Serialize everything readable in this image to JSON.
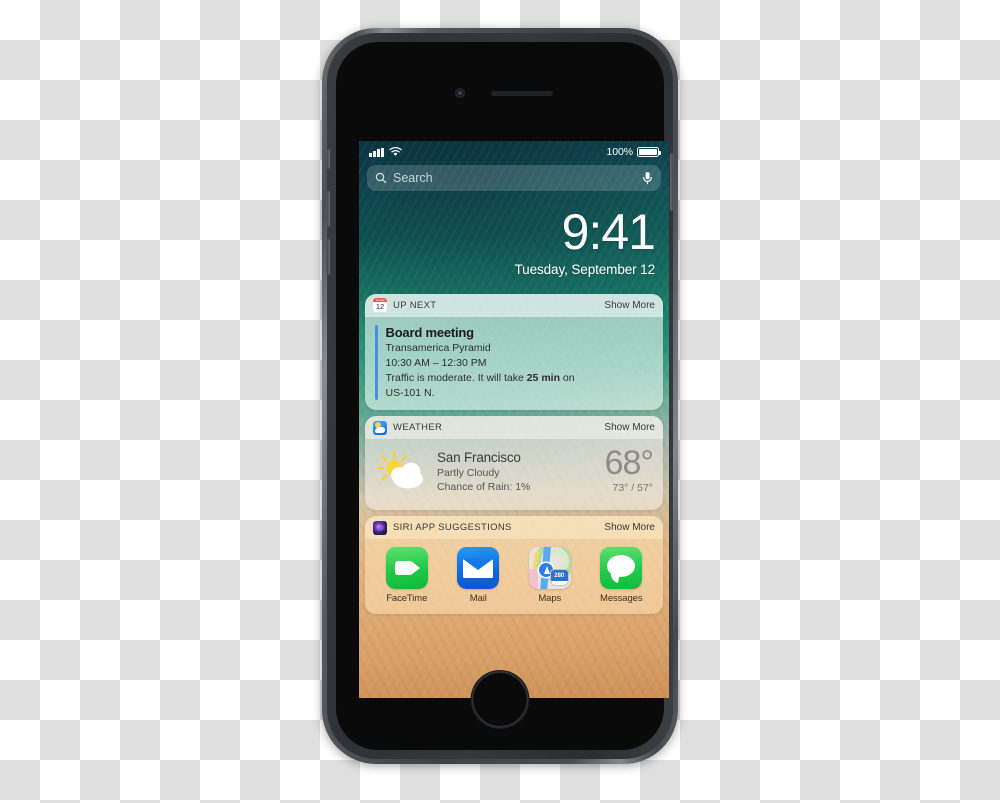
{
  "device": {
    "model_name": "iPhone",
    "home_button": "home-button",
    "camera": "front-camera",
    "speaker": "earpiece-speaker"
  },
  "status_bar": {
    "signal_icon": "cellular-signal-icon",
    "wifi_icon": "wifi-icon",
    "battery_percent": "100%",
    "battery_icon": "battery-full-icon"
  },
  "search": {
    "placeholder": "Search",
    "icon": "search-icon",
    "mic_icon": "microphone-icon"
  },
  "lockscreen": {
    "time": "9:41",
    "date": "Tuesday, September 12"
  },
  "widgets": [
    {
      "id": "up-next",
      "icon": "calendar-icon",
      "title": "UP NEXT",
      "show_more": "Show More",
      "accent_color": "#4a90e2",
      "calendar_icon": {
        "weekday": "Tuesday",
        "day": "12"
      },
      "event": {
        "title": "Board meeting",
        "location": "Transamerica Pyramid",
        "time_range": "10:30 AM – 12:30 PM",
        "traffic_prefix": "Traffic is moderate. It will take ",
        "traffic_duration": "25 min",
        "traffic_suffix": " on",
        "route": "US-101 N."
      }
    },
    {
      "id": "weather",
      "icon": "weather-icon",
      "title": "WEATHER",
      "show_more": "Show More",
      "condition_icon": "sun-behind-cloud-icon",
      "city": "San Francisco",
      "condition": "Partly Cloudy",
      "chance_of_rain": "Chance of Rain: 1%",
      "temperature": "68°",
      "high_low": "73° / 57°"
    },
    {
      "id": "siri-app-suggestions",
      "icon": "siri-icon",
      "title": "SIRI APP SUGGESTIONS",
      "show_more": "Show More",
      "apps": [
        {
          "name": "FaceTime",
          "icon": "facetime-icon",
          "color": "#20c847"
        },
        {
          "name": "Mail",
          "icon": "mail-icon",
          "color": "#1266e0"
        },
        {
          "name": "Maps",
          "icon": "maps-icon",
          "color": "#e9e4da",
          "shield_number": "280"
        },
        {
          "name": "Messages",
          "icon": "messages-icon",
          "color": "#22c94b"
        }
      ]
    }
  ]
}
